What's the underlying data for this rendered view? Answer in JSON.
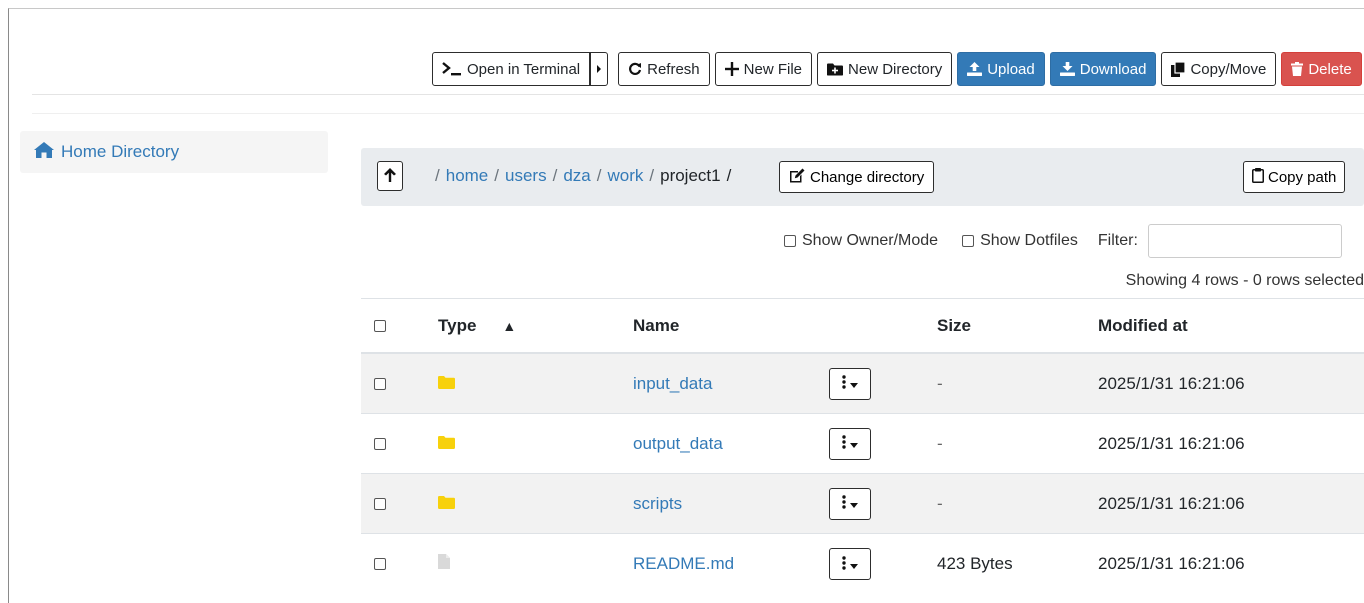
{
  "toolbar": {
    "open_terminal": "Open in Terminal",
    "refresh": "Refresh",
    "new_file": "New File",
    "new_directory": "New Directory",
    "upload": "Upload",
    "download": "Download",
    "copy_move": "Copy/Move",
    "delete": "Delete"
  },
  "sidebar": {
    "home": "Home Directory"
  },
  "breadcrumb": {
    "segments": [
      "home",
      "users",
      "dza",
      "work"
    ],
    "current": "project1",
    "separator": "/",
    "change_directory": "Change directory",
    "copy_path": "Copy path"
  },
  "options": {
    "show_owner_mode": "Show Owner/Mode",
    "show_dotfiles": "Show Dotfiles",
    "filter_label": "Filter:",
    "filter_value": ""
  },
  "status": {
    "showing": "Showing 4 rows - 0 rows selected"
  },
  "table": {
    "headers": {
      "type": "Type",
      "name": "Name",
      "size": "Size",
      "modified": "Modified at"
    },
    "sort_indicator": "▲",
    "rows": [
      {
        "type": "folder",
        "name": "input_data",
        "size": "-",
        "modified": "2025/1/31 16:21:06"
      },
      {
        "type": "folder",
        "name": "output_data",
        "size": "-",
        "modified": "2025/1/31 16:21:06"
      },
      {
        "type": "folder",
        "name": "scripts",
        "size": "-",
        "modified": "2025/1/31 16:21:06"
      },
      {
        "type": "file",
        "name": "README.md",
        "size": "423 Bytes",
        "modified": "2025/1/31 16:21:06"
      }
    ]
  },
  "colors": {
    "primary": "#337ab7",
    "danger": "#d9534f",
    "folder": "#f7d10c",
    "file": "#d9d9d9"
  }
}
